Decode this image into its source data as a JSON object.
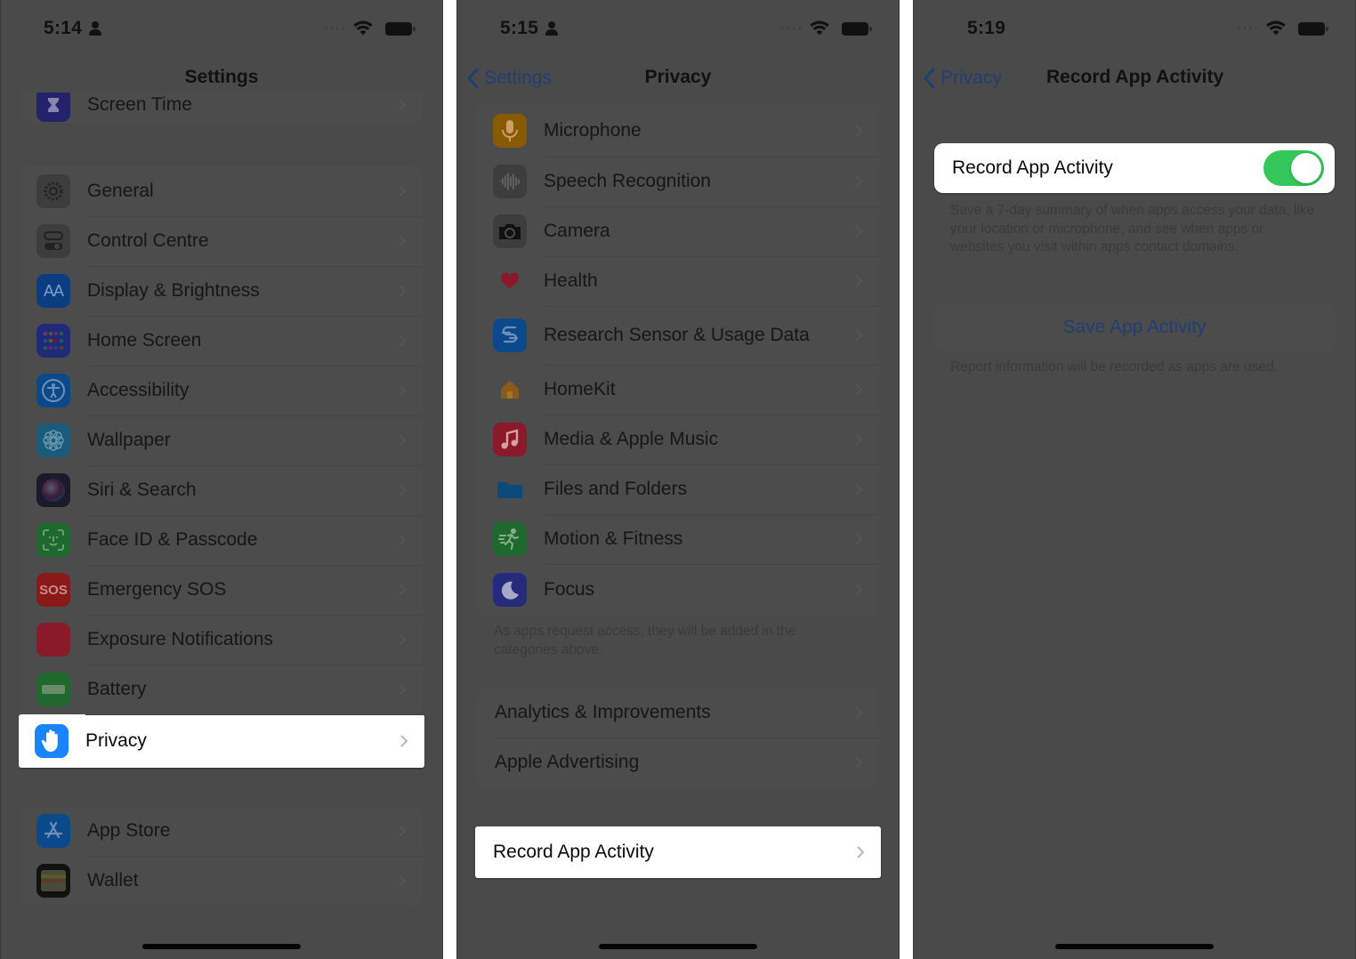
{
  "colors": {
    "dim_background": "#4a4a4a",
    "highlight": "#ffffff",
    "link_blue_dimmed": "#1f3f74",
    "toggle_on": "#34c759"
  },
  "screen1": {
    "status": {
      "time": "5:14",
      "show_person_icon": true
    },
    "nav_title": "Settings",
    "partial_top_item": "Screen Time",
    "group1": [
      {
        "label": "General",
        "icon": "gear-icon",
        "color": "#3d3d3d"
      },
      {
        "label": "Control Centre",
        "icon": "toggles-icon",
        "color": "#3d3d3d"
      },
      {
        "label": "Display & Brightness",
        "icon": "text-size-icon",
        "color": "#0b3d82"
      },
      {
        "label": "Home Screen",
        "icon": "app-grid-icon",
        "color": "#202a7a"
      },
      {
        "label": "Accessibility",
        "icon": "accessibility-icon",
        "color": "#0b4a8a"
      },
      {
        "label": "Wallpaper",
        "icon": "flower-icon",
        "color": "#1a5a7a"
      },
      {
        "label": "Siri & Search",
        "icon": "siri-icon",
        "color": "#1a1a2a"
      },
      {
        "label": "Face ID & Passcode",
        "icon": "face-id-icon",
        "color": "#1e6a2e"
      },
      {
        "label": "Emergency SOS",
        "icon": "sos-icon",
        "color": "#8a1a1a"
      },
      {
        "label": "Exposure Notifications",
        "icon": "exposure-icon",
        "color": "#8a1a2a"
      },
      {
        "label": "Battery",
        "icon": "battery-icon",
        "color": "#1e6a2e"
      },
      {
        "label": "Privacy",
        "icon": "hand-icon",
        "color": "#1a84ff",
        "highlighted": true
      }
    ],
    "group2": [
      {
        "label": "App Store",
        "icon": "app-store-icon",
        "color": "#0b4a8a"
      },
      {
        "label": "Wallet",
        "icon": "wallet-icon",
        "color": "#111111"
      }
    ]
  },
  "screen2": {
    "status": {
      "time": "5:15",
      "show_person_icon": true
    },
    "back_label": "Settings",
    "nav_title": "Privacy",
    "items": [
      {
        "label": "Microphone",
        "icon": "microphone-icon",
        "color": "#8a5a00"
      },
      {
        "label": "Speech Recognition",
        "icon": "waveform-icon",
        "color": "#3d3d3d"
      },
      {
        "label": "Camera",
        "icon": "camera-icon",
        "color": "#3d3d3d"
      },
      {
        "label": "Health",
        "icon": "heart-icon",
        "color": "#4c4c4c"
      },
      {
        "label": "Research Sensor & Usage Data",
        "icon": "research-icon",
        "color": "#0b4a8a"
      },
      {
        "label": "HomeKit",
        "icon": "home-icon",
        "color": "#4c4c4c"
      },
      {
        "label": "Media & Apple Music",
        "icon": "music-note-icon",
        "color": "#8a1a2a"
      },
      {
        "label": "Files and Folders",
        "icon": "folder-icon",
        "color": "#4c4c4c"
      },
      {
        "label": "Motion & Fitness",
        "icon": "running-icon",
        "color": "#1e6a2e"
      },
      {
        "label": "Focus",
        "icon": "moon-icon",
        "color": "#262a7a"
      }
    ],
    "footer": "As apps request access, they will be added in the categories above.",
    "group2": [
      {
        "label": "Analytics & Improvements"
      },
      {
        "label": "Apple Advertising"
      }
    ],
    "record_item": {
      "label": "Record App Activity",
      "highlighted": true
    }
  },
  "screen3": {
    "status": {
      "time": "5:19",
      "show_person_icon": false
    },
    "back_label": "Privacy",
    "nav_title": "Record App Activity",
    "toggle": {
      "label": "Record App Activity",
      "on": true
    },
    "description": "Save a 7-day summary of when apps access your data, like your location or microphone, and see when apps or websites you visit within apps contact domains.",
    "save_button": "Save App Activity",
    "footer": "Report information will be recorded as apps are used."
  }
}
